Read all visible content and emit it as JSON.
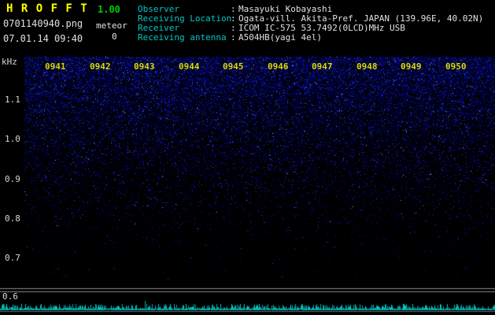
{
  "app": {
    "title": "H R O F F T",
    "version": "1.00",
    "filename": "0701140940.png",
    "mode": "meteor",
    "count": "0",
    "datetime": "07.01.14 09:40"
  },
  "header_info": {
    "separator": ":",
    "rows": [
      {
        "label": "Observer",
        "value": "Masayuki Kobayashi"
      },
      {
        "label": "Receiving Location",
        "value": "Ogata-vill. Akita-Pref. JAPAN (139.96E, 40.02N)"
      },
      {
        "label": "Receiver",
        "value": "ICOM IC-575 53.7492(0LCD)MHz USB"
      },
      {
        "label": "Receiving antenna",
        "value": "A504HB(yagi 4el)"
      }
    ]
  },
  "chart_data": {
    "type": "heatmap",
    "subtype": "radio meteor spectrogram (HROFFT output)",
    "x_axis": "time (HHMM, 1-minute ticks)",
    "x_tick_labels": [
      "0941",
      "0942",
      "0943",
      "0944",
      "0945",
      "0946",
      "0947",
      "0948",
      "0949",
      "0950"
    ],
    "y_axis_label": "kHz",
    "y_tick_labels": [
      "1.1",
      "1.0",
      "0.9",
      "0.8",
      "0.7",
      "0.6"
    ],
    "y_range_khz": [
      0.6,
      1.15
    ],
    "content": "Background noise speckle only; blue noise density is highest near the top (~1.15 kHz) and fades to black toward lower frequencies; no meteor echo traces visible; meteor count shown is 0.",
    "bottom_strip": "Long-term signal-level strip bounded by gray horizontal lines with a noisy cyan baseline trace",
    "colors": {
      "background": "#000000",
      "noise_dim": "#000060",
      "noise_mid": "#2030c0",
      "noise_bright": "#78a0ff",
      "time_labels": "#d8d800",
      "axis_labels": "#d8d8d8",
      "baseline_cyan": "#00c8c8",
      "grid_line": "#8a8a8a",
      "title_yellow": "#ffff00",
      "version_green": "#00cc00",
      "info_label_cyan": "#00c8c8",
      "info_value": "#e0e0e0"
    }
  }
}
